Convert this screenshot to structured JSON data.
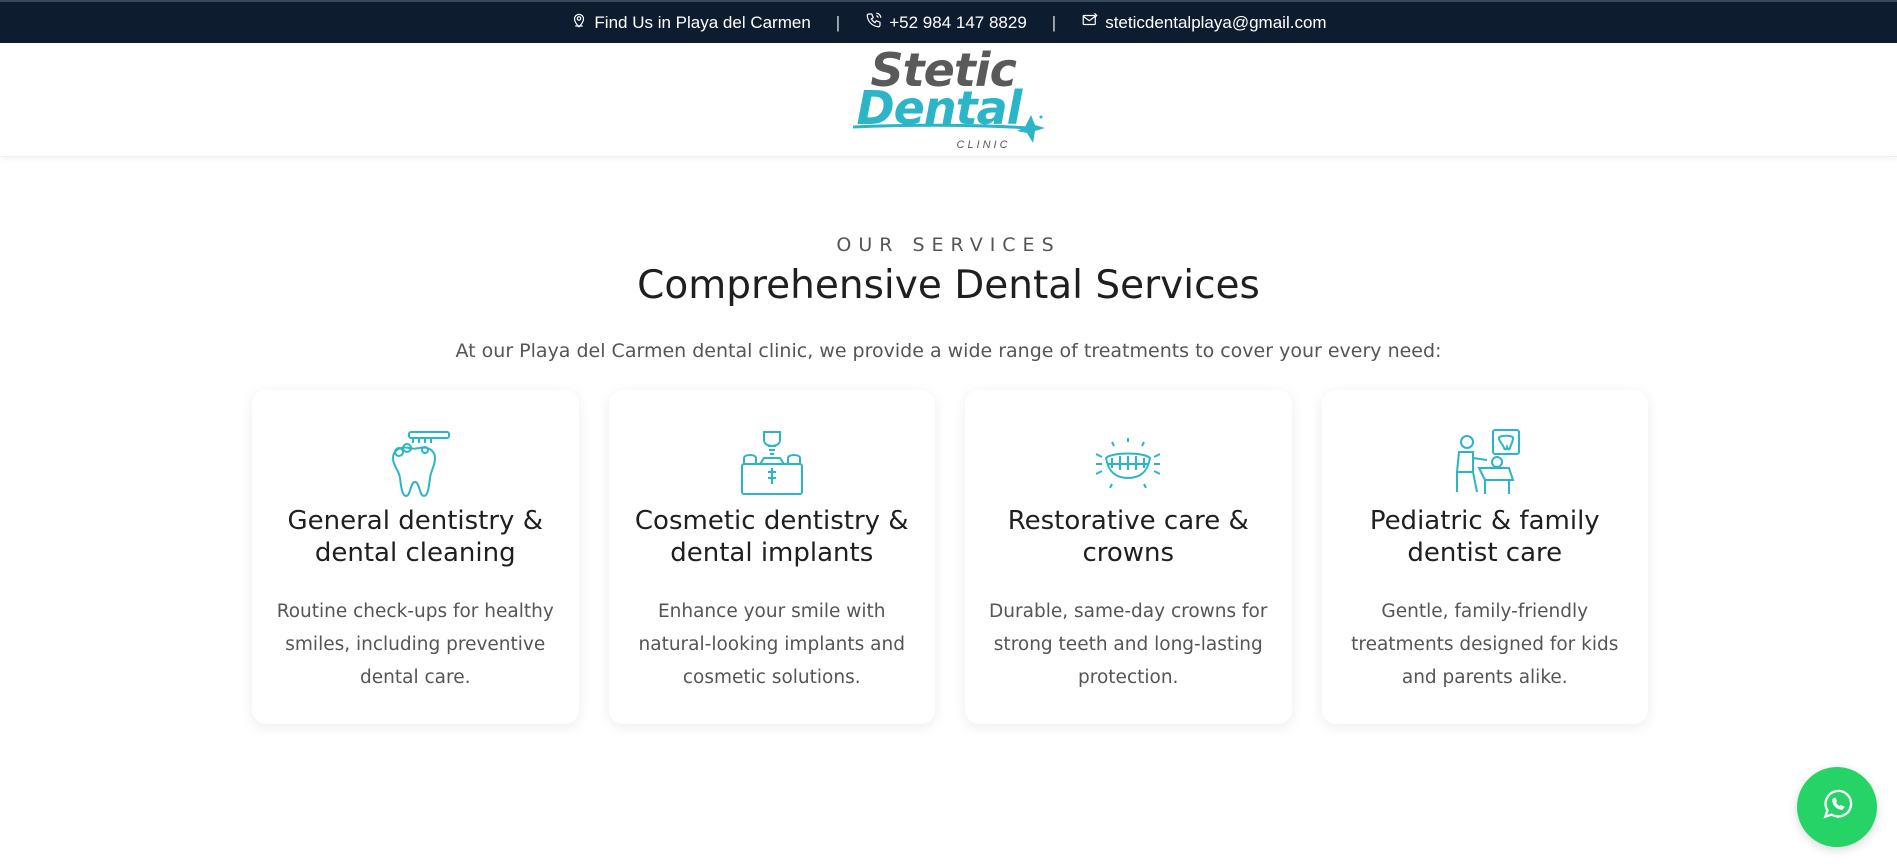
{
  "topbar": {
    "location": "Find Us in Playa del Carmen",
    "phone": "+52 984 147 8829",
    "email": "steticdentalplaya@gmail.com",
    "separator": "|",
    "icons": [
      "location-icon",
      "phone-icon",
      "email-icon"
    ]
  },
  "logo": {
    "line1": "Stetic",
    "line2": "Dental",
    "line3": "CLINIC"
  },
  "services": {
    "eyebrow": "OUR SERVICES",
    "heading": "Comprehensive Dental Services",
    "intro": "At our Playa del Carmen dental clinic, we provide a wide range of treatments to cover your every need:",
    "cards": [
      {
        "icon": "tooth-brush-icon",
        "title": "General dentistry & dental cleaning",
        "desc": "Routine check-ups for healthy smiles, including preventive dental care."
      },
      {
        "icon": "dental-implant-icon",
        "title": "Cosmetic dentistry & dental implants",
        "desc": "Enhance your smile with natural-looking implants and cosmetic solutions."
      },
      {
        "icon": "teeth-crown-icon",
        "title": "Restorative care & crowns",
        "desc": "Durable, same-day crowns for strong teeth and long-lasting protection."
      },
      {
        "icon": "family-dentist-icon",
        "title": "Pediatric & family dentist care",
        "desc": "Gentle, family-friendly treatments designed for kids and parents alike."
      }
    ]
  },
  "whatsapp": {
    "icon": "whatsapp-icon"
  },
  "colors": {
    "topbar_bg": "#0d1c2e",
    "accent": "#2cb5c6",
    "whatsapp": "#25d366"
  }
}
